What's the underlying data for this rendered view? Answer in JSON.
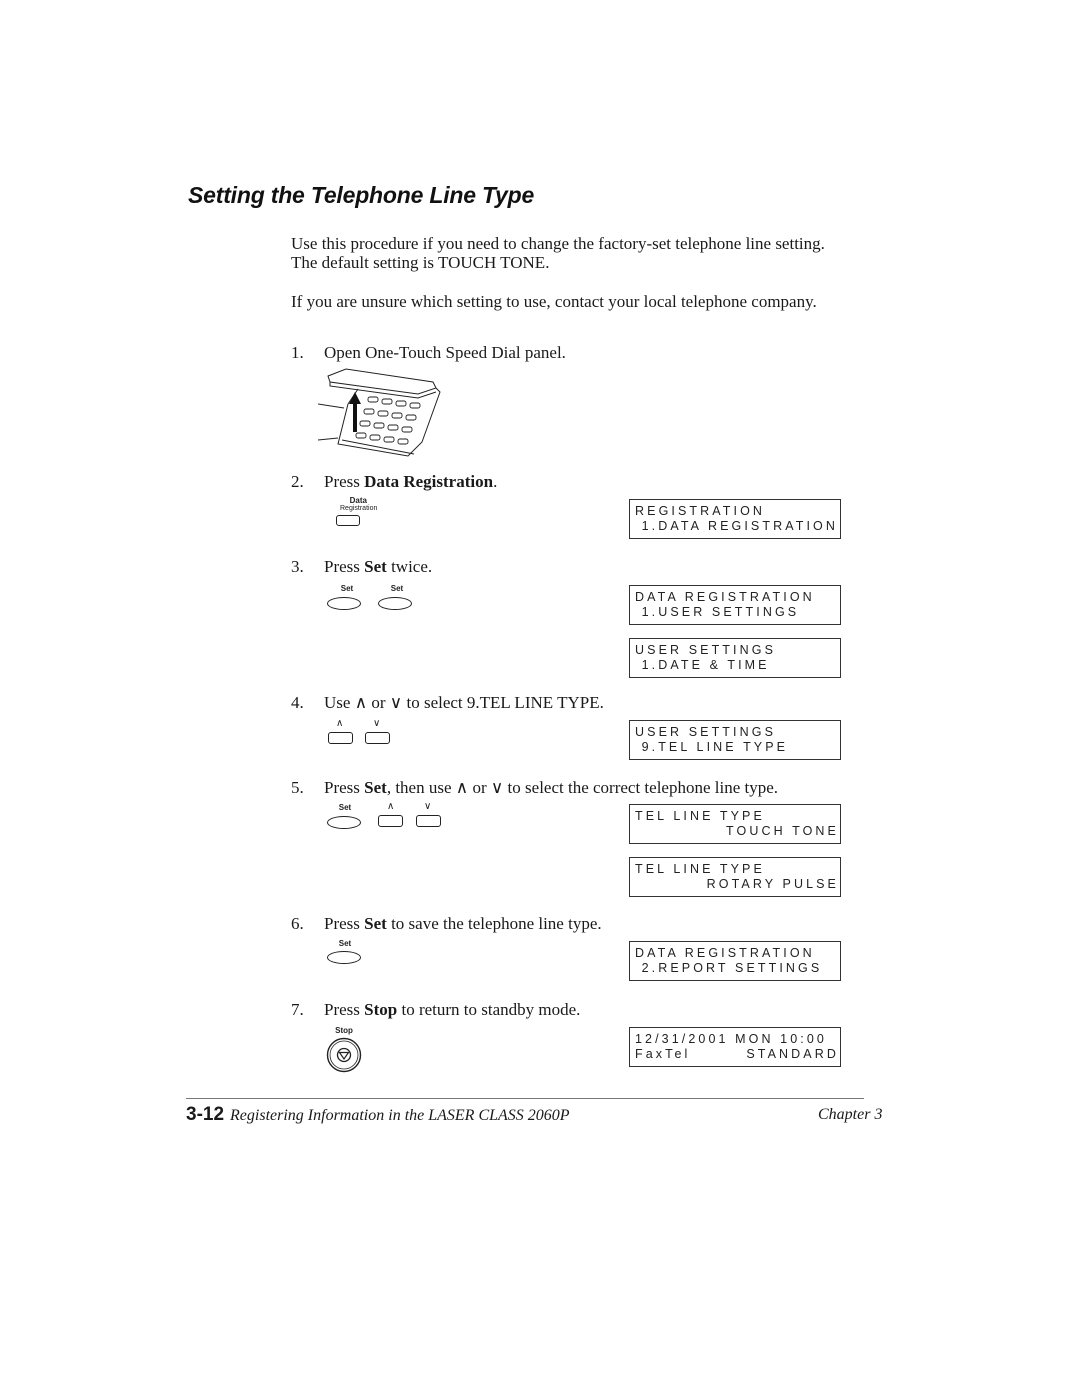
{
  "title": "Setting the Telephone Line Type",
  "intro": [
    "Use this procedure if you need to change the factory-set telephone line setting. The default setting is TOUCH TONE.",
    "If you are unsure which setting to use, contact your local telephone company."
  ],
  "steps": [
    {
      "num": "1.",
      "pre": "Open One-Touch Speed Dial panel.",
      "bold": "",
      "post": ""
    },
    {
      "num": "2.",
      "pre": "Press ",
      "bold": "Data Registration",
      "post": "."
    },
    {
      "num": "3.",
      "pre": "Press ",
      "bold": "Set",
      "post": " twice."
    },
    {
      "num": "4.",
      "pre": "Use ∧ or ∨ to select 9.TEL LINE TYPE.",
      "bold": "",
      "post": ""
    },
    {
      "num": "5.",
      "pre": "Press ",
      "bold": "Set",
      "post": ", then use ∧ or ∨ to select the correct telephone line type."
    },
    {
      "num": "6.",
      "pre": "Press ",
      "bold": "Set",
      "post": " to save the telephone line type."
    },
    {
      "num": "7.",
      "pre": "Press ",
      "bold": "Stop",
      "post": " to return to standby mode."
    }
  ],
  "keys": {
    "data_registration_top": "Data",
    "data_registration_bottom": "Registration",
    "set": "Set",
    "up": "∧",
    "down": "∨",
    "stop": "Stop"
  },
  "displays": [
    {
      "line1": "REGISTRATION",
      "line2": " 1.DATA REGISTRATION"
    },
    {
      "line1": "DATA REGISTRATION",
      "line2": " 1.USER SETTINGS"
    },
    {
      "line1": "USER SETTINGS",
      "line2": " 1.DATE & TIME"
    },
    {
      "line1": "USER SETTINGS",
      "line2": " 9.TEL LINE TYPE"
    },
    {
      "line1": "TEL LINE TYPE",
      "line2": "TOUCH TONE"
    },
    {
      "line1": "TEL LINE TYPE",
      "line2": "ROTARY PULSE"
    },
    {
      "line1": "DATA REGISTRATION",
      "line2": " 2.REPORT SETTINGS"
    },
    {
      "line1": "12/31/2001 MON 10:00",
      "line2_left": "FaxTel",
      "line2_right": "STANDARD"
    }
  ],
  "footer": {
    "page_number": "3-12",
    "section": "Registering Information in the LASER CLASS 2060P",
    "chapter": "Chapter 3"
  }
}
